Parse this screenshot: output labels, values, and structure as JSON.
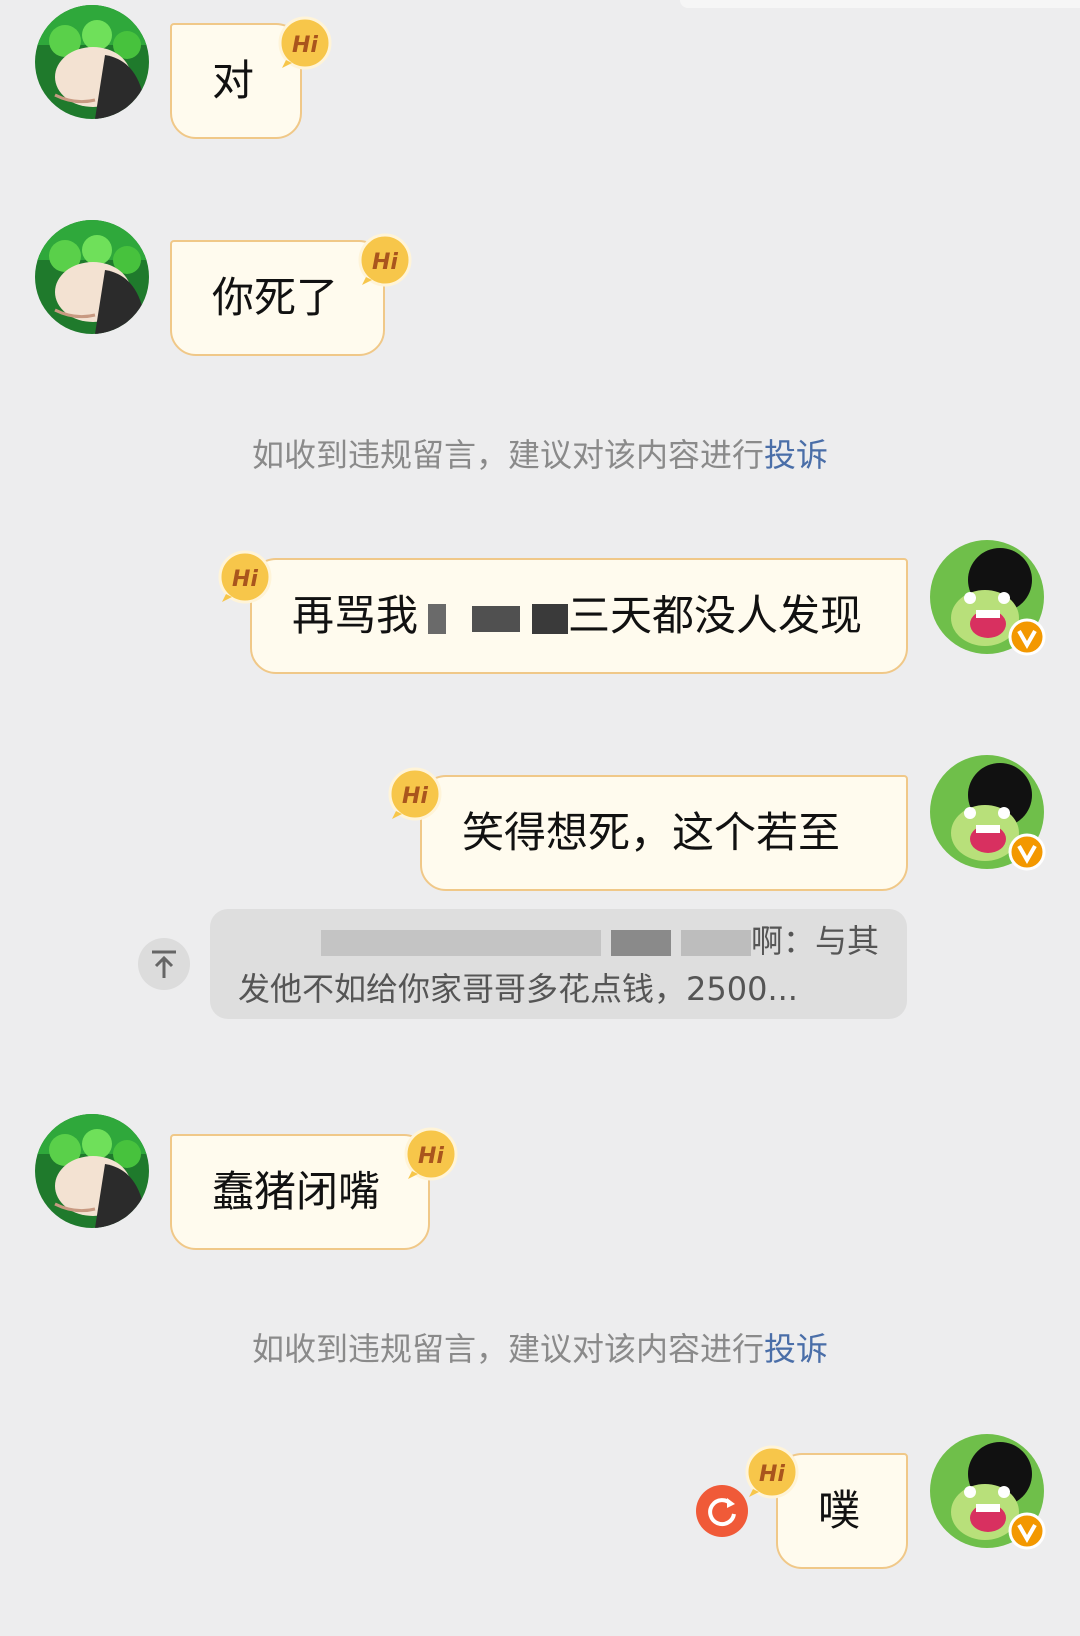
{
  "messages": [
    {
      "side": "left",
      "text": "对"
    },
    {
      "side": "left",
      "text": "你死了"
    },
    {
      "side": "right",
      "text_before": "再骂我",
      "text_after": "三天都没人发现"
    },
    {
      "side": "right",
      "text": "笑得想死，这个若至"
    },
    {
      "side": "left",
      "text": "蠢猪闭嘴"
    },
    {
      "side": "right",
      "text": "噗"
    }
  ],
  "quote": {
    "line1": "啊：与其",
    "line2": "发他不如给你家哥哥多花点钱，2500..."
  },
  "notice": {
    "text": "如收到违规留言，建议对该内容进行",
    "link": "投诉"
  },
  "badge_icon": "hi-badge-icon",
  "colors": {
    "background": "#ededee",
    "bubble": "#fffbee",
    "bubble_border": "#f0c888",
    "link": "#4a6ea8",
    "retry": "#f05a38",
    "verified": "#f39800"
  }
}
